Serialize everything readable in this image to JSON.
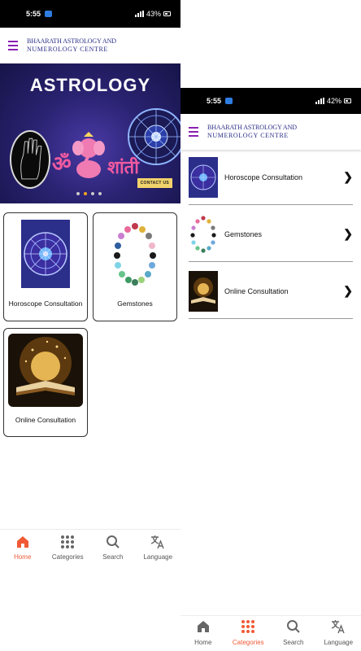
{
  "left": {
    "status": {
      "time": "5:55",
      "battery": "43%"
    },
    "header": {
      "title_line1": "BHAARATH ASTROLOGY AND",
      "title_line2": "NUMEROLOGY CENTRE"
    },
    "banner": {
      "title": "ASTROLOGY",
      "om_text": "ॐ",
      "shanti_text": "शांती",
      "contact_label": "CONTACT US",
      "slide_count": 4,
      "active_slide": 2
    },
    "categories": [
      {
        "label": "Horoscope Consultation",
        "icon": "zodiac-wheel"
      },
      {
        "label": "Gemstones",
        "icon": "gemstone-ring"
      },
      {
        "label": "Online Consultation",
        "icon": "glowing-book"
      }
    ],
    "tabs": [
      {
        "label": "Home",
        "icon": "home-icon",
        "active": true
      },
      {
        "label": "Categories",
        "icon": "grid-icon",
        "active": false
      },
      {
        "label": "Search",
        "icon": "search-icon",
        "active": false
      },
      {
        "label": "Language",
        "icon": "translate-icon",
        "active": false
      }
    ]
  },
  "right": {
    "status": {
      "time": "5:55",
      "battery": "42%"
    },
    "header": {
      "title_line1": "BHAARATH ASTROLOGY AND",
      "title_line2": "NUMEROLOGY CENTRE"
    },
    "list": [
      {
        "label": "Horoscope Consultation"
      },
      {
        "label": "Gemstones"
      },
      {
        "label": "Online Consultation"
      }
    ],
    "tabs": [
      {
        "label": "Home",
        "icon": "home-icon",
        "active": false
      },
      {
        "label": "Categories",
        "icon": "grid-icon",
        "active": true
      },
      {
        "label": "Search",
        "icon": "search-icon",
        "active": false
      },
      {
        "label": "Language",
        "icon": "translate-icon",
        "active": false
      }
    ]
  },
  "colors": {
    "accent": "#f05a35",
    "brand": "#2a2d86",
    "menu": "#8a1fb3",
    "banner_bg": "#2a2372"
  }
}
